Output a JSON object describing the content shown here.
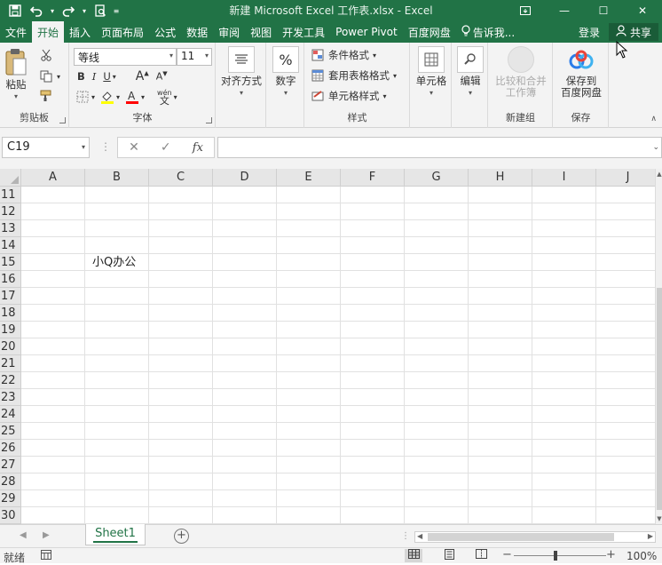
{
  "title_bar": {
    "title": "新建 Microsoft Excel 工作表.xlsx - Excel",
    "save_icon": "save-icon",
    "undo_icon": "undo-icon",
    "redo_icon": "redo-icon",
    "print_preview_icon": "print-preview-icon"
  },
  "tabs": [
    "文件",
    "开始",
    "插入",
    "页面布局",
    "公式",
    "数据",
    "审阅",
    "视图",
    "开发工具",
    "Power Pivot",
    "百度网盘"
  ],
  "active_tab": "开始",
  "tell_me": "告诉我...",
  "login": "登录",
  "share": "共享",
  "ribbon": {
    "clipboard": {
      "paste": "粘贴",
      "label": "剪贴板"
    },
    "font": {
      "font_name": "等线",
      "font_size": "11",
      "bold": "B",
      "italic": "I",
      "underline": "U",
      "grow": "A",
      "shrink": "A",
      "wen": "wén",
      "wen_char": "文",
      "label": "字体",
      "font_color": "#ff0000",
      "fill_color": "#ffff00"
    },
    "alignment": {
      "label": "对齐方式"
    },
    "number": {
      "label": "数字",
      "icon_text": "%"
    },
    "styles": {
      "cond_format": "条件格式",
      "table_format": "套用表格格式",
      "cell_style": "单元格样式",
      "label": "样式"
    },
    "cells": {
      "label": "单元格"
    },
    "editing": {
      "label": "编辑"
    },
    "compare": {
      "line1": "比较和合并",
      "line2": "工作簿",
      "label": "新建组"
    },
    "save_baidu": {
      "line1": "保存到",
      "line2": "百度网盘",
      "label": "保存"
    }
  },
  "formula_bar": {
    "name_box": "C19",
    "cancel": "✕",
    "enter": "✓",
    "fx": "fx",
    "value": ""
  },
  "grid": {
    "columns": [
      "A",
      "B",
      "C",
      "D",
      "E",
      "F",
      "G",
      "H",
      "I",
      "J"
    ],
    "rows": [
      "11",
      "12",
      "13",
      "14",
      "15",
      "16",
      "17",
      "18",
      "19",
      "20",
      "21",
      "22",
      "23",
      "24",
      "25",
      "26",
      "27",
      "28",
      "29",
      "30"
    ],
    "cells": [
      {
        "ref": "B15",
        "value": "小Q办公"
      }
    ]
  },
  "sheets": {
    "active": "Sheet1",
    "add": "+"
  },
  "status": {
    "ready": "就绪",
    "zoom": "100%"
  }
}
